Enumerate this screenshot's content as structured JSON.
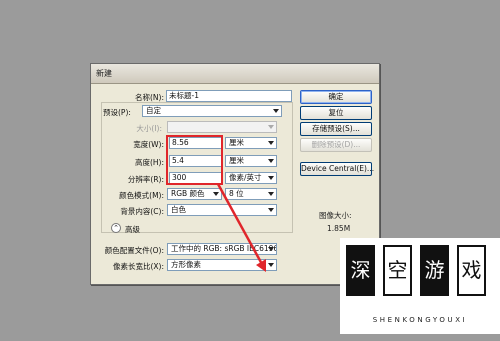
{
  "dialog": {
    "title": "新建",
    "name_label": "名称(N):",
    "name_value": "未标题-1",
    "preset_label": "预设(P):",
    "preset_value": "自定",
    "size_label": "大小(I):",
    "width_label": "宽度(W):",
    "width_value": "8.56",
    "width_unit": "厘米",
    "height_label": "高度(H):",
    "height_value": "5.4",
    "height_unit": "厘米",
    "resolution_label": "分辨率(R):",
    "resolution_value": "300",
    "resolution_unit": "像素/英寸",
    "color_mode_label": "颜色模式(M):",
    "color_mode_value": "RGB 颜色",
    "bit_depth_value": "8 位",
    "background_label": "背景内容(C):",
    "background_value": "白色",
    "advanced_label": "高级",
    "color_profile_label": "颜色配置文件(O):",
    "color_profile_value": "工作中的 RGB: sRGB IEC6196...",
    "pixel_aspect_label": "像素长宽比(X):",
    "pixel_aspect_value": "方形像素"
  },
  "buttons": {
    "ok": "确定",
    "reset": "复位",
    "save_preset": "存储预设(S)...",
    "delete_preset": "删除预设(D)...",
    "device_central": "Device Central(E)..."
  },
  "image_size": {
    "label": "图像大小:",
    "value": "1.85M"
  },
  "watermark": {
    "chars": [
      "深",
      "空",
      "游",
      "戏"
    ],
    "slogan": "SHENKONGYOUXI"
  },
  "colors": {
    "highlight_box": "#e0262b",
    "arrow": "#e0262b"
  }
}
